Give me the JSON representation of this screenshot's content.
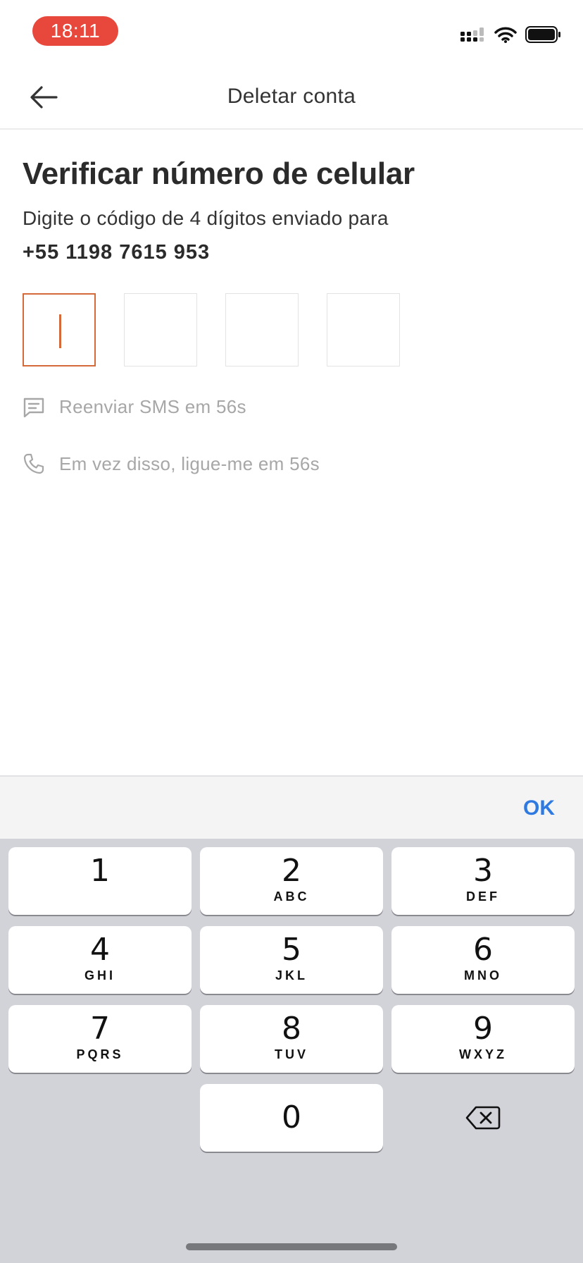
{
  "status_bar": {
    "time": "18:11"
  },
  "nav": {
    "title": "Deletar conta"
  },
  "content": {
    "heading": "Verificar número de celular",
    "subtitle": "Digite o código de 4 dígitos enviado para",
    "phone": "+55 1198 7615 953",
    "resend_sms": "Reenviar SMS em 56s",
    "call_me": "Em vez disso, ligue-me em 56s"
  },
  "keyboard": {
    "ok_label": "OK",
    "keys": [
      {
        "num": "1",
        "letters": ""
      },
      {
        "num": "2",
        "letters": "ABC"
      },
      {
        "num": "3",
        "letters": "DEF"
      },
      {
        "num": "4",
        "letters": "GHI"
      },
      {
        "num": "5",
        "letters": "JKL"
      },
      {
        "num": "6",
        "letters": "MNO"
      },
      {
        "num": "7",
        "letters": "PQRS"
      },
      {
        "num": "8",
        "letters": "TUV"
      },
      {
        "num": "9",
        "letters": "WXYZ"
      },
      {
        "num": "0",
        "letters": ""
      }
    ]
  },
  "colors": {
    "accent": "#d4693a",
    "time_pill": "#e8473b",
    "ok_blue": "#2f7ae0"
  }
}
